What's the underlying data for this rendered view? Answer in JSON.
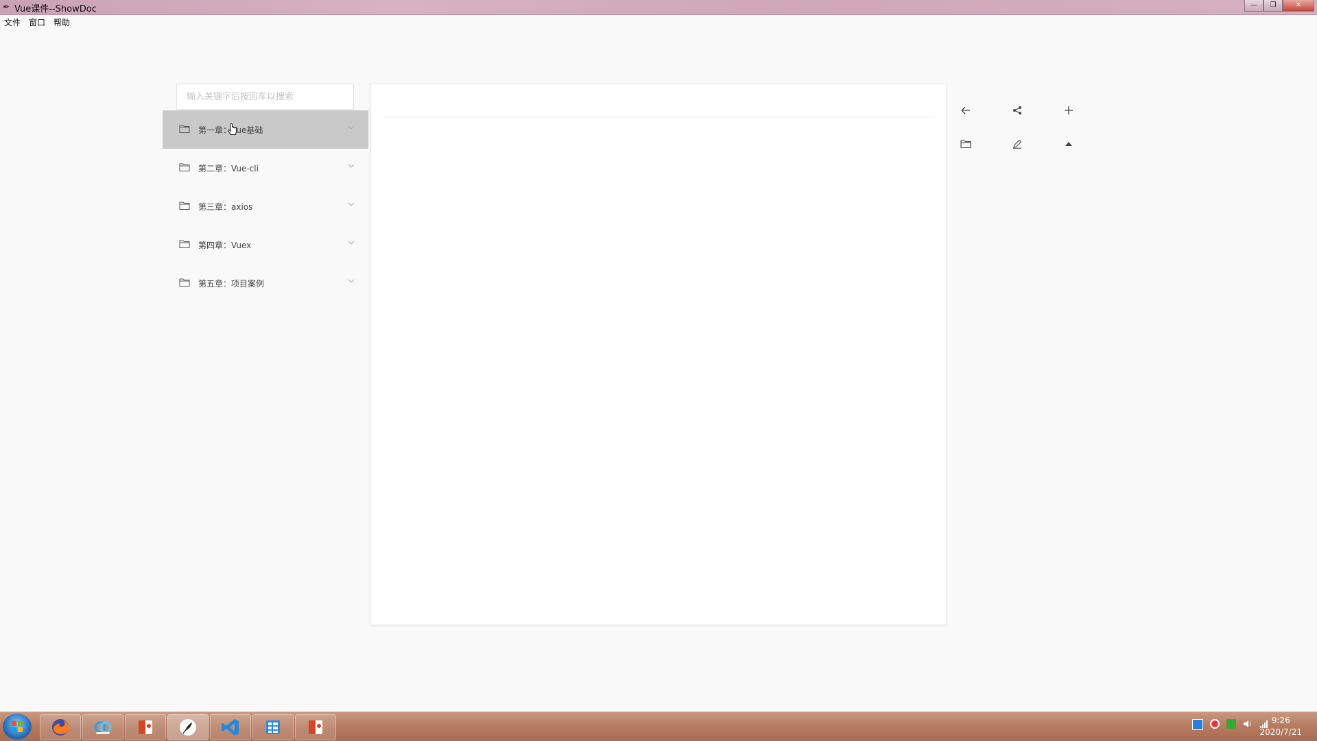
{
  "window": {
    "title": "Vue课件--ShowDoc",
    "minimize": "—",
    "maximize": "❐",
    "close": "✕"
  },
  "menu": [
    "文件",
    "窗口",
    "帮助"
  ],
  "search": {
    "placeholder": "输入关键字后按回车以搜索"
  },
  "tree": [
    {
      "label": "第一章：Vue基础",
      "active": true
    },
    {
      "label": "第二章：Vue-cli",
      "active": false
    },
    {
      "label": "第三章：axios",
      "active": false
    },
    {
      "label": "第四章：Vuex",
      "active": false
    },
    {
      "label": "第五章：项目案例",
      "active": false
    }
  ],
  "toolbar": {
    "icons": [
      "back-icon",
      "share-icon",
      "plus-icon",
      "folder-icon",
      "edit-icon",
      "caret-up-icon"
    ]
  },
  "taskbar": {
    "apps": [
      "firefox-icon",
      "baidu-netdisk-icon",
      "powerpoint-icon",
      "feather-icon",
      "vscode-icon",
      "list-app-icon",
      "powerpoint-icon"
    ],
    "clock_time": "9:26",
    "clock_date": "2020/7/21"
  },
  "colors": {
    "active_item_bg": "#c9c9c9",
    "taskbar": "#b57a5f",
    "titlebar": "#d0a9ba"
  }
}
